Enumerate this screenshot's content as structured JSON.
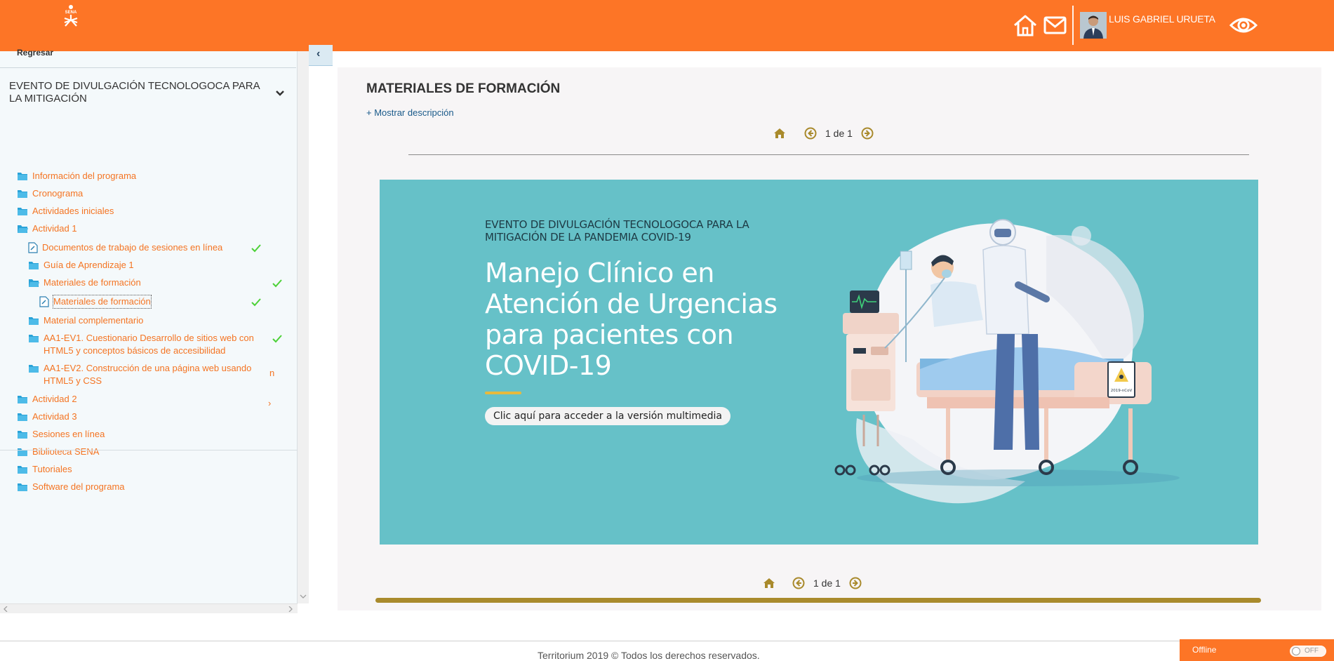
{
  "header": {
    "user_name": "LUIS GABRIEL URUETA"
  },
  "sidebar": {
    "back_label": "Regresar",
    "program_title": "EVENTO DE DIVULGACIÓN TECNOLOGOCA PARA LA MITIGACIÓN",
    "items": [
      {
        "label": "Información del programa",
        "type": "folder",
        "level": 0
      },
      {
        "label": "Cronograma",
        "type": "folder",
        "level": 0
      },
      {
        "label": "Actividades iniciales",
        "type": "folder",
        "level": 0
      },
      {
        "label": "Actividad 1",
        "type": "folder",
        "level": 0
      },
      {
        "label": "Documentos de trabajo de sesiones en línea",
        "type": "doc",
        "level": 1,
        "checked": true
      },
      {
        "label": "Guía de Aprendizaje 1",
        "type": "folder",
        "level": 1
      },
      {
        "label": "Materiales de formación",
        "type": "folder",
        "level": 1,
        "checked": true
      },
      {
        "label": "Materiales de formación",
        "type": "doc",
        "level": 2,
        "checked": true,
        "selected": true
      },
      {
        "label": "Material complementario",
        "type": "folder",
        "level": 1
      },
      {
        "label": "AA1-EV1. Cuestionario Desarrollo de sitios web con HTML5 y conceptos básicos de accesibilidad",
        "type": "folder",
        "level": 1,
        "checked": true
      },
      {
        "label": "AA1-EV2. Construcción de una página web usando HTML5 y CSS",
        "type": "folder",
        "level": 1,
        "marker": "n"
      },
      {
        "label": "Actividad 2",
        "type": "folder",
        "level": 0,
        "marker": "›"
      },
      {
        "label": "Actividad 3",
        "type": "folder",
        "level": 0
      },
      {
        "label": "Sesiones en línea",
        "type": "folder",
        "level": 0
      },
      {
        "label": "Biblioteca SENA",
        "type": "folder",
        "level": 0
      },
      {
        "label": "Tutoriales",
        "type": "folder",
        "level": 0
      },
      {
        "label": "Software del programa",
        "type": "folder",
        "level": 0
      }
    ]
  },
  "main": {
    "heading": "MATERIALES DE FORMACIÓN",
    "show_description": "+ Mostrar descripción",
    "pager_text": "1 de 1",
    "banner": {
      "subtitle": "EVENTO DE DIVULGACIÓN TECNOLOGOCA PARA LA MITIGACIÓN DE LA PANDEMIA COVID-19",
      "title": "Manejo Clínico en Atención de Urgencias para pacientes con COVID-19",
      "button_label": "Clic aquí para acceder a la versión multimedia",
      "sign_text": "2019-nCoV"
    },
    "progress": 1.0
  },
  "footer": {
    "copyright": "Territorium 2019 © Todos los derechos reservados.",
    "status": "Offline",
    "toggle_label": "OFF"
  },
  "colors": {
    "brand_orange": "#fd7526",
    "link_orange": "#f47422",
    "banner_teal": "#66c1c8",
    "accent_gold": "#a98a2c",
    "check_green": "#4cd137"
  }
}
